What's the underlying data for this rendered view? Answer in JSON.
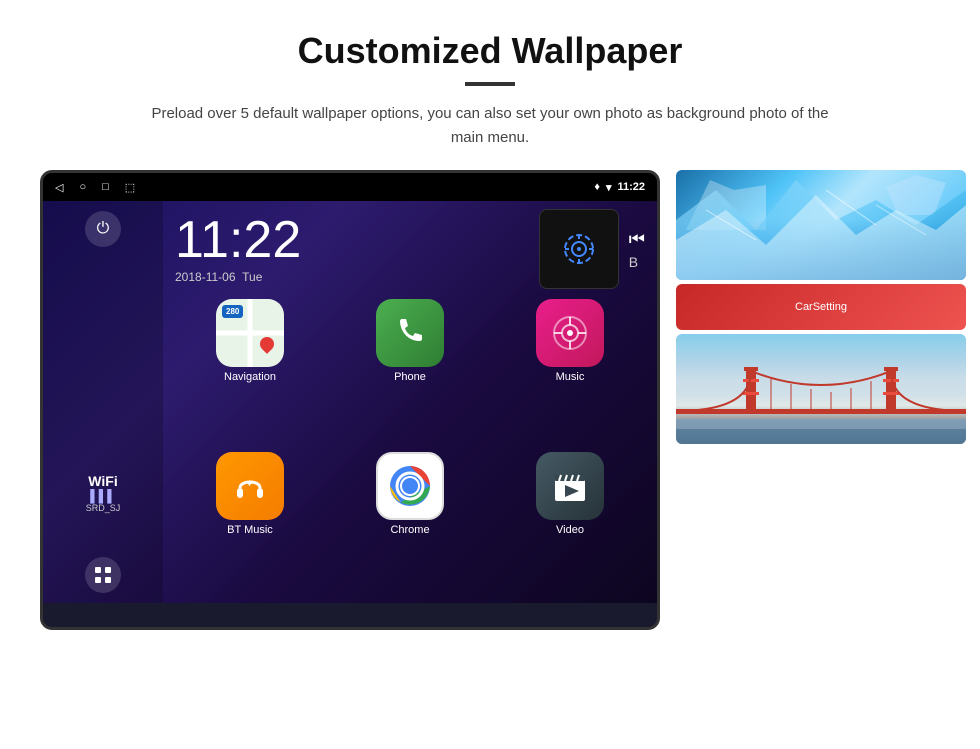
{
  "header": {
    "title": "Customized Wallpaper",
    "subtitle": "Preload over 5 default wallpaper options, you can also set your own photo as background photo of the main menu."
  },
  "device": {
    "status_bar": {
      "time": "11:22",
      "location_icon": "📍",
      "wifi_icon": "▾",
      "back_btn": "◁",
      "home_btn": "○",
      "recents_btn": "□",
      "screenshot_btn": "⬚"
    },
    "clock": {
      "time": "11:22",
      "date": "2018-11-06",
      "day": "Tue"
    },
    "wifi": {
      "label": "WiFi",
      "ssid": "SRD_SJ"
    },
    "apps": [
      {
        "id": "navigation",
        "label": "Navigation",
        "badge": "280"
      },
      {
        "id": "phone",
        "label": "Phone"
      },
      {
        "id": "music",
        "label": "Music"
      },
      {
        "id": "btmusic",
        "label": "BT Music"
      },
      {
        "id": "chrome",
        "label": "Chrome"
      },
      {
        "id": "video",
        "label": "Video"
      }
    ],
    "carsetting": {
      "label": "CarSetting"
    }
  }
}
